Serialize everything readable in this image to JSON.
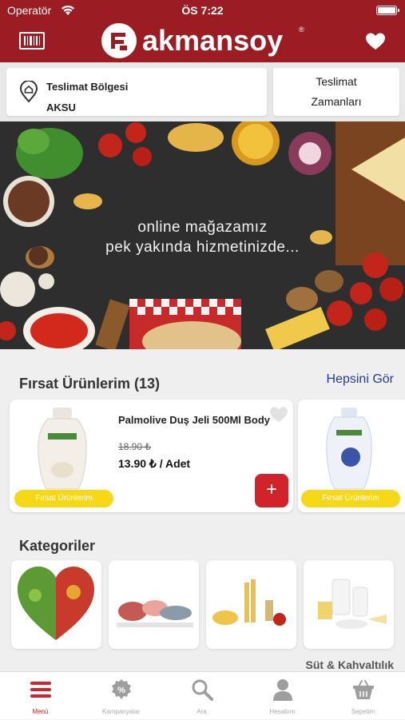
{
  "status": {
    "carrier": "Operatör",
    "time": "ÖS 7:22"
  },
  "header": {
    "brand": "akmansoy",
    "registered": "®"
  },
  "delivery": {
    "region_label": "Teslimat Bölgesi",
    "region_value": "AKSU",
    "times_line1": "Teslimat",
    "times_line2": "Zamanları"
  },
  "banner": {
    "line1": "online mağazamız",
    "line2": "pek yakında hizmetinizde..."
  },
  "offers": {
    "title": "Fırsat Ürünlerim (13)",
    "see_all": "Hepsini Gör",
    "items": [
      {
        "name": "Palmolive Duş Jeli 500Ml Body",
        "old_price": "18.90 ₺",
        "price": "13.90 ₺ / Adet",
        "badge": "Fırsat Ürünlerim",
        "add": "+"
      },
      {
        "badge": "Fırsat Ürünlerim"
      }
    ]
  },
  "categories": {
    "title": "Kategoriler",
    "visible_label": "Süt & Kahvaltılık"
  },
  "tabs": [
    {
      "label": "Menü",
      "icon": "menu-icon",
      "active": true
    },
    {
      "label": "Kampanyalar",
      "icon": "percent-icon"
    },
    {
      "label": "Ara",
      "icon": "search-icon"
    },
    {
      "label": "Hesabım",
      "icon": "user-icon"
    },
    {
      "label": "Sepetim",
      "icon": "basket-icon"
    }
  ],
  "colors": {
    "brand": "#9b1c22",
    "accent": "#d2232a",
    "badge": "#f6d816",
    "link": "#2a3a9c"
  }
}
